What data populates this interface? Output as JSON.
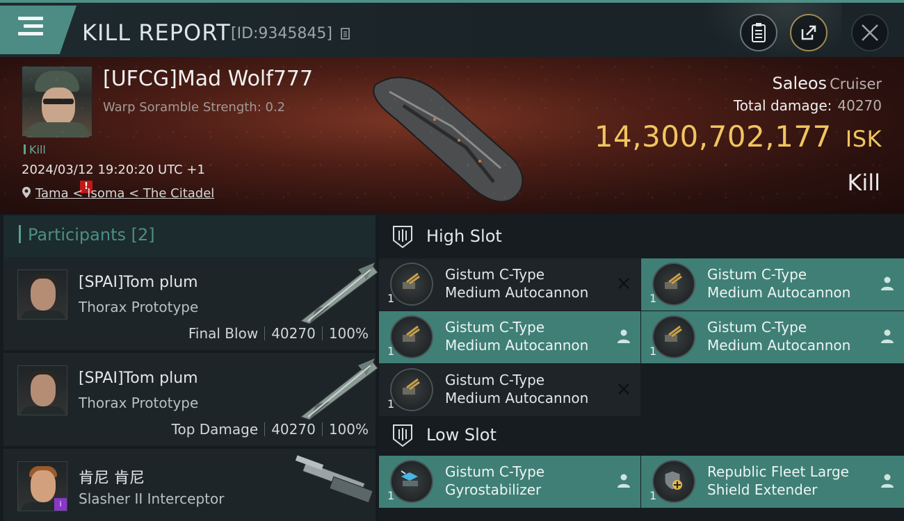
{
  "header": {
    "title": "KILL REPORT",
    "report_id": "[ID:9345845]"
  },
  "victim": {
    "name": "[UFCG]Mad Wolf777",
    "warp_strength": "Warp Soramble Strength: 0.2",
    "kill_tag": "Kill",
    "timestamp": "2024/03/12 19:20:20 UTC +1",
    "location": "Tama < Isoma < The Citadel",
    "alert_badge": "!"
  },
  "ship": {
    "name": "Saleos",
    "class": "Cruiser",
    "total_damage_label": "Total damage:",
    "total_damage": "40270",
    "isk_value": "14,300,702,177",
    "isk_unit": "ISK",
    "result": "Kill"
  },
  "participants": {
    "label": "Participants",
    "count": "[2]",
    "items": [
      {
        "name": "[SPAI]Tom plum",
        "ship": "Thorax Prototype",
        "role": "Final Blow",
        "damage": "40270",
        "percent": "100%"
      },
      {
        "name": "[SPAI]Tom plum",
        "ship": "Thorax Prototype",
        "role": "Top Damage",
        "damage": "40270",
        "percent": "100%"
      },
      {
        "name": "肯尼 肯尼",
        "ship": "Slasher II Interceptor",
        "badge": "i"
      }
    ]
  },
  "slots": {
    "high": {
      "label": "High Slot",
      "modules": [
        {
          "line1": "Gistum C-Type",
          "line2": "Medium Autocannon",
          "qty": "1",
          "state": "destroyed"
        },
        {
          "line1": "Gistum C-Type",
          "line2": "Medium Autocannon",
          "qty": "1",
          "state": "dropped"
        },
        {
          "line1": "Gistum C-Type",
          "line2": "Medium Autocannon",
          "qty": "1",
          "state": "dropped"
        },
        {
          "line1": "Gistum C-Type",
          "line2": "Medium Autocannon",
          "qty": "1",
          "state": "dropped"
        },
        {
          "line1": "Gistum C-Type",
          "line2": "Medium Autocannon",
          "qty": "1",
          "state": "destroyed"
        }
      ]
    },
    "low": {
      "label": "Low Slot",
      "modules": [
        {
          "line1": "Gistum C-Type",
          "line2": "Gyrostabilizer",
          "qty": "1",
          "state": "dropped"
        },
        {
          "line1": "Republic Fleet Large",
          "line2": "Shield Extender",
          "qty": "1",
          "state": "dropped"
        }
      ]
    }
  },
  "colors": {
    "accent": "#4d8c84",
    "isk": "#f0c560",
    "dropped": "#3f7f76",
    "destroyed": "#1e2428"
  }
}
